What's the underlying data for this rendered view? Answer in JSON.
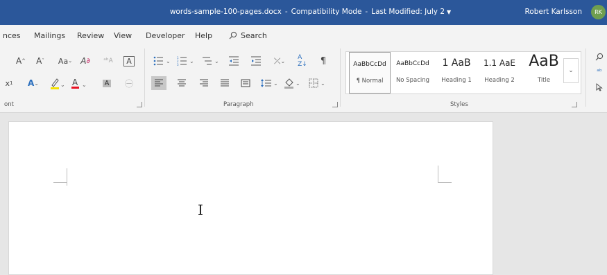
{
  "titlebar": {
    "file_name": "words-sample-100-pages.docx",
    "mode": "Compatibility Mode",
    "last_modified": "Last Modified: July 2",
    "user_name": "Robert Karlsson",
    "avatar_initials": "RK",
    "color": "#2b579a"
  },
  "menubar": {
    "tabs": [
      "nces",
      "Mailings",
      "Review",
      "View",
      "Developer",
      "Help"
    ],
    "search_label": "Search"
  },
  "ribbon": {
    "groups": {
      "font": "ont",
      "paragraph": "Paragraph",
      "styles": "Styles"
    },
    "styles": [
      {
        "preview": "AaBbCcDd",
        "name": "¶ Normal",
        "selected": true
      },
      {
        "preview": "AaBbCcDd",
        "name": "No Spacing"
      },
      {
        "preview": "1 AaB",
        "name": "Heading 1"
      },
      {
        "preview": "1.1 AaE",
        "name": "Heading 2"
      },
      {
        "preview": "AaB",
        "name": "Title"
      }
    ],
    "icons": {
      "font_row1": [
        "grow-font-icon",
        "shrink-font-icon",
        "change-case-icon",
        "clear-formatting-icon",
        "phonetic-guide-icon",
        "character-border-icon"
      ],
      "font_row2": [
        "superscript-icon",
        "text-effects-icon",
        "highlight-icon",
        "font-color-icon",
        "character-shading-icon",
        "enclose-characters-icon"
      ],
      "para_row1": [
        "bullets-icon",
        "numbering-icon",
        "multilevel-list-icon",
        "decrease-indent-icon",
        "increase-indent-icon",
        "asian-layout-icon",
        "sort-icon",
        "show-formatting-icon"
      ],
      "para_row2": [
        "align-left-icon",
        "center-icon",
        "align-right-icon",
        "justify-icon",
        "distributed-icon",
        "line-spacing-icon",
        "shading-icon",
        "borders-icon"
      ],
      "editing": [
        "find-icon",
        "replace-icon",
        "select-icon"
      ]
    }
  }
}
